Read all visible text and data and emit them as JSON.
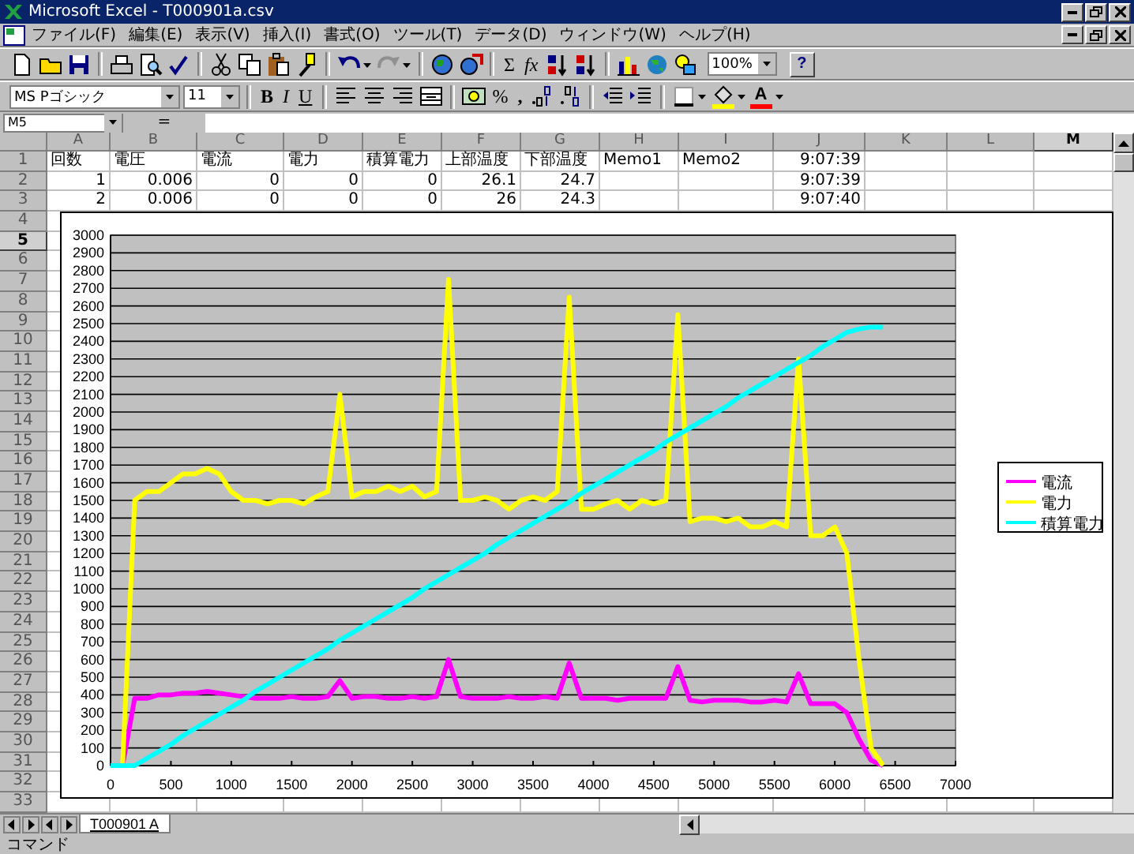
{
  "window": {
    "title": "Microsoft Excel - T000901a.csv"
  },
  "menu": [
    "ファイル(F)",
    "編集(E)",
    "表示(V)",
    "挿入(I)",
    "書式(O)",
    "ツール(T)",
    "データ(D)",
    "ウィンドウ(W)",
    "ヘルプ(H)"
  ],
  "toolbar": {
    "sum": "Σ",
    "function": "fx",
    "zoom": "100%",
    "help": "?",
    "redo_disabled": true
  },
  "format_toolbar": {
    "font": "MS Pゴシック",
    "size": "11",
    "bold": "B",
    "italic": "I",
    "underline": "U",
    "percent": "%",
    "comma": ",",
    "font_color": "A"
  },
  "formula_bar": {
    "name_box": "M5",
    "equals": "="
  },
  "sheet": {
    "columns": [
      {
        "label": "A",
        "selected": false
      },
      {
        "label": "B",
        "selected": false
      },
      {
        "label": "C",
        "selected": false
      },
      {
        "label": "D",
        "selected": false
      },
      {
        "label": "E",
        "selected": false
      },
      {
        "label": "F",
        "selected": false
      },
      {
        "label": "G",
        "selected": false
      },
      {
        "label": "H",
        "selected": false
      },
      {
        "label": "I",
        "selected": false
      },
      {
        "label": "J",
        "selected": false
      },
      {
        "label": "K",
        "selected": false
      },
      {
        "label": "L",
        "selected": false
      },
      {
        "label": "M",
        "selected": true
      }
    ],
    "row_headers": [
      {
        "label": "1",
        "selected": false
      },
      {
        "label": "2",
        "selected": false
      },
      {
        "label": "3",
        "selected": false
      },
      {
        "label": "4",
        "selected": false
      },
      {
        "label": "5",
        "selected": true
      },
      {
        "label": "6",
        "selected": false
      },
      {
        "label": "7",
        "selected": false
      },
      {
        "label": "8",
        "selected": false
      },
      {
        "label": "9",
        "selected": false
      },
      {
        "label": "10",
        "selected": false
      },
      {
        "label": "11",
        "selected": false
      },
      {
        "label": "12",
        "selected": false
      },
      {
        "label": "13",
        "selected": false
      },
      {
        "label": "14",
        "selected": false
      },
      {
        "label": "15",
        "selected": false
      },
      {
        "label": "16",
        "selected": false
      },
      {
        "label": "17",
        "selected": false
      },
      {
        "label": "18",
        "selected": false
      },
      {
        "label": "19",
        "selected": false
      },
      {
        "label": "20",
        "selected": false
      },
      {
        "label": "21",
        "selected": false
      },
      {
        "label": "22",
        "selected": false
      },
      {
        "label": "23",
        "selected": false
      },
      {
        "label": "24",
        "selected": false
      },
      {
        "label": "25",
        "selected": false
      },
      {
        "label": "26",
        "selected": false
      },
      {
        "label": "27",
        "selected": false
      },
      {
        "label": "28",
        "selected": false
      },
      {
        "label": "29",
        "selected": false
      },
      {
        "label": "30",
        "selected": false
      },
      {
        "label": "31",
        "selected": false
      },
      {
        "label": "32",
        "selected": false
      },
      {
        "label": "33",
        "selected": false
      }
    ],
    "rows": [
      [
        {
          "text": "回数",
          "numeric": false
        },
        {
          "text": "電圧",
          "numeric": false
        },
        {
          "text": "電流",
          "numeric": false
        },
        {
          "text": "電力",
          "numeric": false
        },
        {
          "text": "積算電力",
          "numeric": false
        },
        {
          "text": "上部温度",
          "numeric": false
        },
        {
          "text": "下部温度",
          "numeric": false
        },
        {
          "text": "Memo1",
          "numeric": false
        },
        {
          "text": "Memo2",
          "numeric": false
        },
        {
          "text": "9:07:39",
          "numeric": true
        }
      ],
      [
        {
          "text": "1",
          "numeric": true
        },
        {
          "text": "0.006",
          "numeric": true
        },
        {
          "text": "0",
          "numeric": true
        },
        {
          "text": "0",
          "numeric": true
        },
        {
          "text": "0",
          "numeric": true
        },
        {
          "text": "26.1",
          "numeric": true
        },
        {
          "text": "24.7",
          "numeric": true
        },
        null,
        null,
        {
          "text": "9:07:39",
          "numeric": true
        }
      ],
      [
        {
          "text": "2",
          "numeric": true
        },
        {
          "text": "0.006",
          "numeric": true
        },
        {
          "text": "0",
          "numeric": true
        },
        {
          "text": "0",
          "numeric": true
        },
        {
          "text": "0",
          "numeric": true
        },
        {
          "text": "26",
          "numeric": true
        },
        {
          "text": "24.3",
          "numeric": true
        },
        null,
        null,
        {
          "text": "9:07:40",
          "numeric": true
        }
      ]
    ]
  },
  "chart": {
    "chart_data": {
      "type": "line",
      "x": [
        0,
        100,
        200,
        300,
        400,
        500,
        600,
        700,
        800,
        900,
        1000,
        1100,
        1200,
        1300,
        1400,
        1500,
        1600,
        1700,
        1800,
        1900,
        2000,
        2100,
        2200,
        2300,
        2400,
        2500,
        2600,
        2700,
        2800,
        2900,
        3000,
        3100,
        3200,
        3300,
        3400,
        3500,
        3600,
        3700,
        3800,
        3900,
        4000,
        4100,
        4200,
        4300,
        4400,
        4500,
        4600,
        4700,
        4800,
        4900,
        5000,
        5100,
        5200,
        5300,
        5400,
        5500,
        5600,
        5700,
        5800,
        5900,
        6000,
        6100,
        6200,
        6300,
        6400
      ],
      "series": [
        {
          "name": "電流",
          "color": "#ff00ff",
          "values": [
            0,
            0,
            380,
            380,
            400,
            400,
            410,
            410,
            420,
            410,
            400,
            390,
            380,
            380,
            380,
            390,
            380,
            380,
            390,
            480,
            380,
            390,
            390,
            380,
            380,
            390,
            380,
            390,
            600,
            390,
            380,
            380,
            380,
            390,
            380,
            380,
            390,
            380,
            580,
            380,
            380,
            380,
            370,
            380,
            380,
            380,
            380,
            560,
            370,
            360,
            370,
            370,
            370,
            360,
            360,
            370,
            360,
            520,
            350,
            350,
            350,
            300,
            150,
            30,
            0
          ]
        },
        {
          "name": "電力",
          "color": "#ffff00",
          "values": [
            0,
            0,
            1500,
            1550,
            1550,
            1600,
            1650,
            1650,
            1680,
            1650,
            1550,
            1500,
            1500,
            1480,
            1500,
            1500,
            1480,
            1520,
            1550,
            2100,
            1520,
            1550,
            1550,
            1580,
            1550,
            1580,
            1520,
            1550,
            2750,
            1500,
            1500,
            1520,
            1500,
            1450,
            1500,
            1520,
            1500,
            1550,
            2650,
            1450,
            1450,
            1480,
            1500,
            1450,
            1500,
            1480,
            1500,
            2550,
            1380,
            1400,
            1400,
            1380,
            1400,
            1350,
            1350,
            1380,
            1350,
            2300,
            1300,
            1300,
            1350,
            1200,
            600,
            100,
            0
          ]
        },
        {
          "name": "積算電力",
          "color": "#00ffff",
          "values": [
            0,
            0,
            0,
            40,
            80,
            120,
            170,
            210,
            250,
            290,
            330,
            370,
            420,
            460,
            500,
            540,
            580,
            620,
            660,
            710,
            750,
            790,
            830,
            870,
            910,
            950,
            1000,
            1040,
            1080,
            1120,
            1160,
            1200,
            1250,
            1290,
            1330,
            1370,
            1410,
            1450,
            1490,
            1540,
            1580,
            1620,
            1660,
            1700,
            1740,
            1780,
            1830,
            1870,
            1910,
            1950,
            1990,
            2030,
            2080,
            2120,
            2160,
            2200,
            2240,
            2280,
            2320,
            2370,
            2410,
            2450,
            2470,
            2480,
            2480
          ]
        }
      ],
      "xlim": [
        0,
        7000
      ],
      "ylim": [
        0,
        3000
      ],
      "grid": true,
      "legend": "right",
      "xticks": [
        0,
        500,
        1000,
        1500,
        2000,
        2500,
        3000,
        3500,
        4000,
        4500,
        5000,
        5500,
        6000,
        6500,
        7000
      ],
      "yticks": [
        0,
        100,
        200,
        300,
        400,
        500,
        600,
        700,
        800,
        900,
        1000,
        1100,
        1200,
        1300,
        1400,
        1500,
        1600,
        1700,
        1800,
        1900,
        2000,
        2100,
        2200,
        2300,
        2400,
        2500,
        2600,
        2700,
        2800,
        2900,
        3000
      ]
    }
  },
  "sheet_tabs": [
    {
      "label": "T000901 A",
      "selected": true
    }
  ],
  "status_bar": {
    "text": "コマンド"
  }
}
